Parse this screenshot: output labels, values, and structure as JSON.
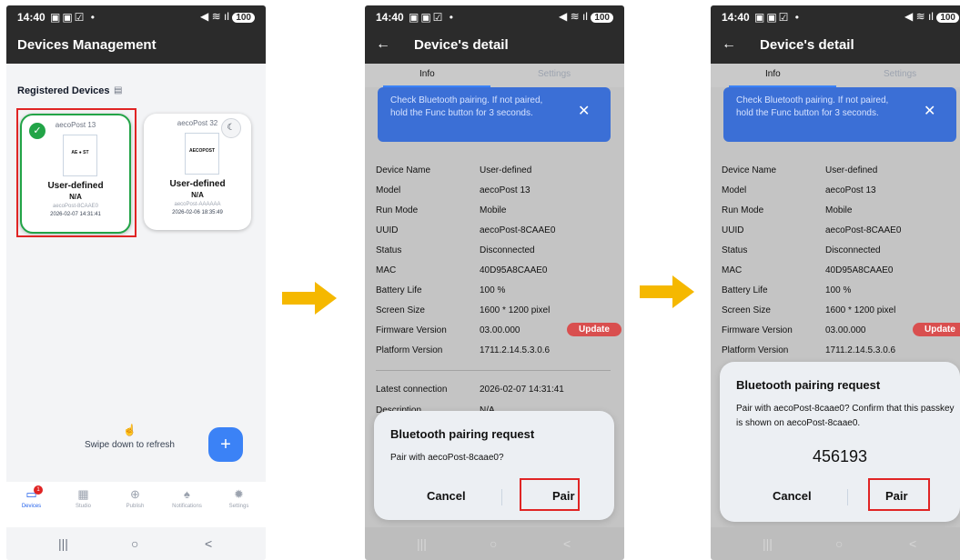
{
  "status": {
    "time": "14:40",
    "icons": "▣▣☑ •",
    "signal": "◀ ≋ ıl",
    "battery": "100"
  },
  "screen1": {
    "title": "Devices Management",
    "section_label": "Registered Devices",
    "devices": [
      {
        "name": "aecoPost 13",
        "logo": "AE ● ST",
        "label": "User-defined",
        "value": "N/A",
        "id": "aecoPost-8CAAE0",
        "date": "2026-02-07 14:31:41",
        "selected": true
      },
      {
        "name": "aecoPost 32",
        "logo": "AECOPOST",
        "label": "User-defined",
        "value": "N/A",
        "id": "aecoPost-AAAAAA",
        "date": "2026-02-06 18:35:49",
        "selected": false
      }
    ],
    "refresh_hint": "Swipe down to refresh",
    "fab": "+",
    "nav": [
      {
        "label": "Devices",
        "icon": "▭",
        "active": true,
        "badge": "1"
      },
      {
        "label": "Studio",
        "icon": "▦",
        "active": false
      },
      {
        "label": "Publish",
        "icon": "⊕",
        "active": false
      },
      {
        "label": "Notifications",
        "icon": "♠",
        "active": false
      },
      {
        "label": "Settings",
        "icon": "✹",
        "active": false
      }
    ],
    "sys_nav": [
      "|||",
      "○",
      "<"
    ]
  },
  "detail": {
    "title": "Device's detail",
    "tabs": [
      "Info",
      "Settings"
    ],
    "banner": "Check Bluetooth pairing. If not paired, hold the Func button for 3 seconds.",
    "rows": [
      {
        "k": "Device Name",
        "v": "User-defined"
      },
      {
        "k": "Model",
        "v": "aecoPost 13"
      },
      {
        "k": "Run Mode",
        "v": "Mobile"
      },
      {
        "k": "UUID",
        "v": "aecoPost-8CAAE0"
      },
      {
        "k": "Status",
        "v": "Disconnected"
      },
      {
        "k": "MAC",
        "v": "40D95A8CAAE0"
      },
      {
        "k": "Battery Life",
        "v": "100 %"
      },
      {
        "k": "Screen Size",
        "v": "1600 * 1200 pixel"
      },
      {
        "k": "Firmware Version",
        "v": "03.00.000"
      },
      {
        "k": "Platform Version",
        "v": "1711.2.14.5.3.0.6"
      }
    ],
    "update_label": "Update",
    "latest": {
      "k": "Latest connection",
      "v": "2026-02-07 14:31:41"
    },
    "desc": {
      "k": "Description",
      "v": "N/A"
    }
  },
  "dialog1": {
    "title": "Bluetooth pairing request",
    "message": "Pair with aecoPost-8caae0?",
    "cancel": "Cancel",
    "pair": "Pair"
  },
  "dialog2": {
    "title": "Bluetooth pairing request",
    "message": "Pair with aecoPost-8caae0? Confirm that this passkey is shown on aecoPost-8caae0.",
    "passkey": "456193",
    "cancel": "Cancel",
    "pair": "Pair"
  },
  "colors": {
    "accent": "#3b82f6",
    "selected": "#22a447",
    "highlight": "#e02424",
    "arrow": "#f5b800"
  }
}
